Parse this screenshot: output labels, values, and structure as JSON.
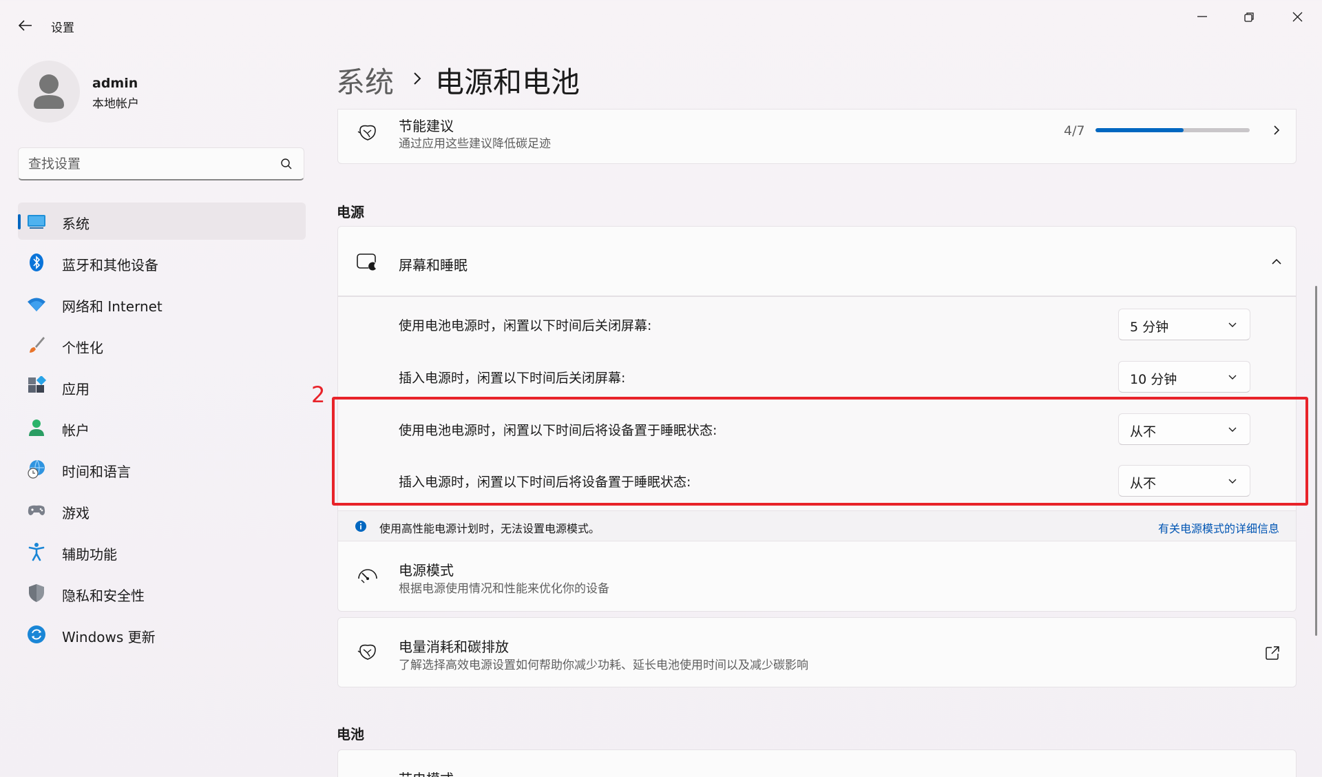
{
  "window": {
    "title": "设置",
    "controls": {
      "minimize": "minimize-icon",
      "maximize": "restore-icon",
      "close": "close-icon"
    }
  },
  "user": {
    "name": "admin",
    "account_type": "本地帐户"
  },
  "search": {
    "placeholder": "查找设置",
    "value": ""
  },
  "sidebar": {
    "items": [
      {
        "label": "系统",
        "icon": "system-icon",
        "active": true
      },
      {
        "label": "蓝牙和其他设备",
        "icon": "bluetooth-icon",
        "active": false
      },
      {
        "label": "网络和 Internet",
        "icon": "wifi-icon",
        "active": false
      },
      {
        "label": "个性化",
        "icon": "brush-icon",
        "active": false
      },
      {
        "label": "应用",
        "icon": "apps-icon",
        "active": false
      },
      {
        "label": "帐户",
        "icon": "account-icon",
        "active": false
      },
      {
        "label": "时间和语言",
        "icon": "globe-clock-icon",
        "active": false
      },
      {
        "label": "游戏",
        "icon": "gamepad-icon",
        "active": false
      },
      {
        "label": "辅助功能",
        "icon": "accessibility-icon",
        "active": false
      },
      {
        "label": "隐私和安全性",
        "icon": "shield-icon",
        "active": false
      },
      {
        "label": "Windows 更新",
        "icon": "update-icon",
        "active": false
      }
    ]
  },
  "breadcrumb": {
    "parent": "系统",
    "separator": "›",
    "current": "电源和电池"
  },
  "energy_card": {
    "title": "节能建议",
    "subtitle": "通过应用这些建议降低碳足迹",
    "progress_text": "4/7",
    "progress_fraction": 0.571
  },
  "power_section": {
    "label": "电源"
  },
  "screen_sleep": {
    "title": "屏幕和睡眠",
    "rows": [
      {
        "label": "使用电池电源时，闲置以下时间后关闭屏幕:",
        "value": "5 分钟"
      },
      {
        "label": "插入电源时，闲置以下时间后关闭屏幕:",
        "value": "10 分钟"
      },
      {
        "label": "使用电池电源时，闲置以下时间后将设备置于睡眠状态:",
        "value": "从不"
      },
      {
        "label": "插入电源时，闲置以下时间后将设备置于睡眠状态:",
        "value": "从不"
      }
    ]
  },
  "info_bar": {
    "text": "使用高性能电源计划时，无法设置电源模式。",
    "link": "有关电源模式的详细信息"
  },
  "power_mode": {
    "title": "电源模式",
    "subtitle": "根据电源使用情况和性能来优化你的设备"
  },
  "carbon_card": {
    "title": "电量消耗和碳排放",
    "subtitle": "了解选择高效电源设置如何帮助你减少功耗、延长电池使用时间以及减少碳影响"
  },
  "battery_section": {
    "label": "电池"
  },
  "battery_saver": {
    "title": "节电模式"
  },
  "annotation": {
    "number": "2",
    "color": "#e8232a"
  },
  "colors": {
    "accent": "#0067c0",
    "link": "#0055b3",
    "annotation": "#e8232a"
  }
}
